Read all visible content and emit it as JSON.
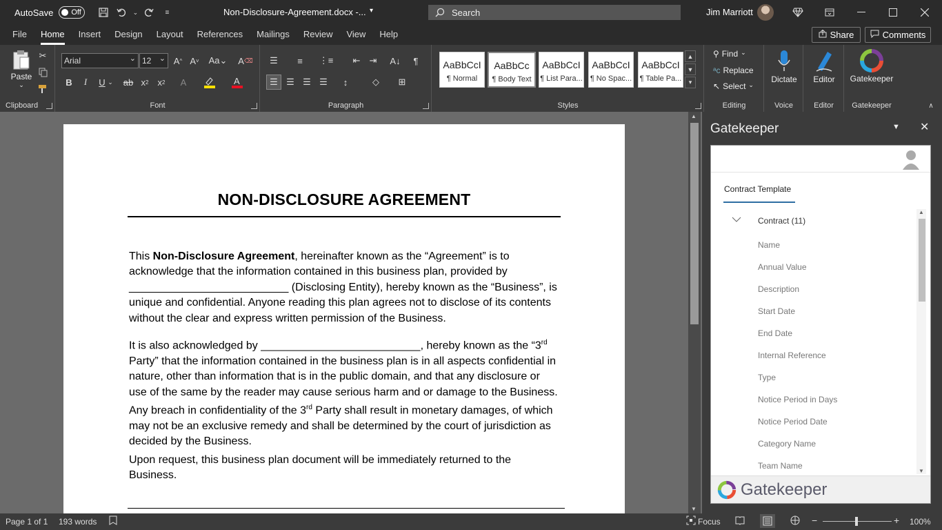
{
  "titlebar": {
    "autosave_label": "AutoSave",
    "autosave_state": "Off",
    "doc_title": "Non-Disclosure-Agreement.docx  -...",
    "search_placeholder": "Search",
    "user_name": "Jim Marriott"
  },
  "tabs": [
    "File",
    "Home",
    "Insert",
    "Design",
    "Layout",
    "References",
    "Mailings",
    "Review",
    "View",
    "Help"
  ],
  "active_tab": "Home",
  "share_label": "Share",
  "comments_label": "Comments",
  "ribbon": {
    "clipboard": {
      "label": "Clipboard",
      "paste": "Paste"
    },
    "font": {
      "label": "Font",
      "font_name": "Arial",
      "font_size": "12"
    },
    "paragraph": {
      "label": "Paragraph"
    },
    "styles": {
      "label": "Styles",
      "items": [
        {
          "preview": "AaBbCcI",
          "name": "¶ Normal"
        },
        {
          "preview": "AaBbCc",
          "name": "¶ Body Text"
        },
        {
          "preview": "AaBbCcI",
          "name": "¶ List Para..."
        },
        {
          "preview": "AaBbCcI",
          "name": "¶ No Spac..."
        },
        {
          "preview": "AaBbCcI",
          "name": "¶ Table Pa..."
        }
      ]
    },
    "editing": {
      "label": "Editing",
      "find": "Find",
      "replace": "Replace",
      "select": "Select"
    },
    "voice": {
      "label": "Voice",
      "dictate": "Dictate"
    },
    "editor": {
      "label": "Editor",
      "editor": "Editor"
    },
    "gatekeeper": {
      "label": "Gatekeeper",
      "gatekeeper": "Gatekeeper"
    }
  },
  "document": {
    "title": "NON-DISCLOSURE AGREEMENT",
    "p1_a": "This ",
    "p1_bold": "Non-Disclosure Agreement",
    "p1_b": ", hereinafter known as the “Agreement” is to acknowledge that the information contained in this business plan, provided by __________________________ (Disclosing Entity), hereby known as the “Business”, is unique and confidential. Anyone reading this plan agrees not to disclose of its contents without the clear and express written permission of the Business.",
    "p2_a": "It is also acknowledged by __________________________, hereby known as the “3",
    "p2_sup1": "rd",
    "p2_b": " Party” that the information contained in the business plan is in all aspects confidential in nature, other than information that is in the public domain, and that any disclosure or use of the same by the reader may cause serious harm and or damage to the Business. Any breach in confidentiality of the 3",
    "p2_sup2": "rd",
    "p2_c": " Party shall result in monetary damages, of which may not be an exclusive remedy and shall be determined by the court of jurisdiction as decided by the Business.",
    "p3": "Upon request, this business plan document will be immediately returned to the Business."
  },
  "pane": {
    "title": "Gatekeeper",
    "tab": "Contract Template",
    "tree_head": "Contract (11)",
    "fields": [
      "Name",
      "Annual Value",
      "Description",
      "Start Date",
      "End Date",
      "Internal Reference",
      "Type",
      "Notice Period in Days",
      "Notice Period Date",
      "Category Name",
      "Team Name"
    ],
    "footer_logo_text": "Gatekeeper"
  },
  "status": {
    "page": "Page 1 of 1",
    "words": "193 words",
    "focus": "Focus",
    "zoom": "100%"
  }
}
